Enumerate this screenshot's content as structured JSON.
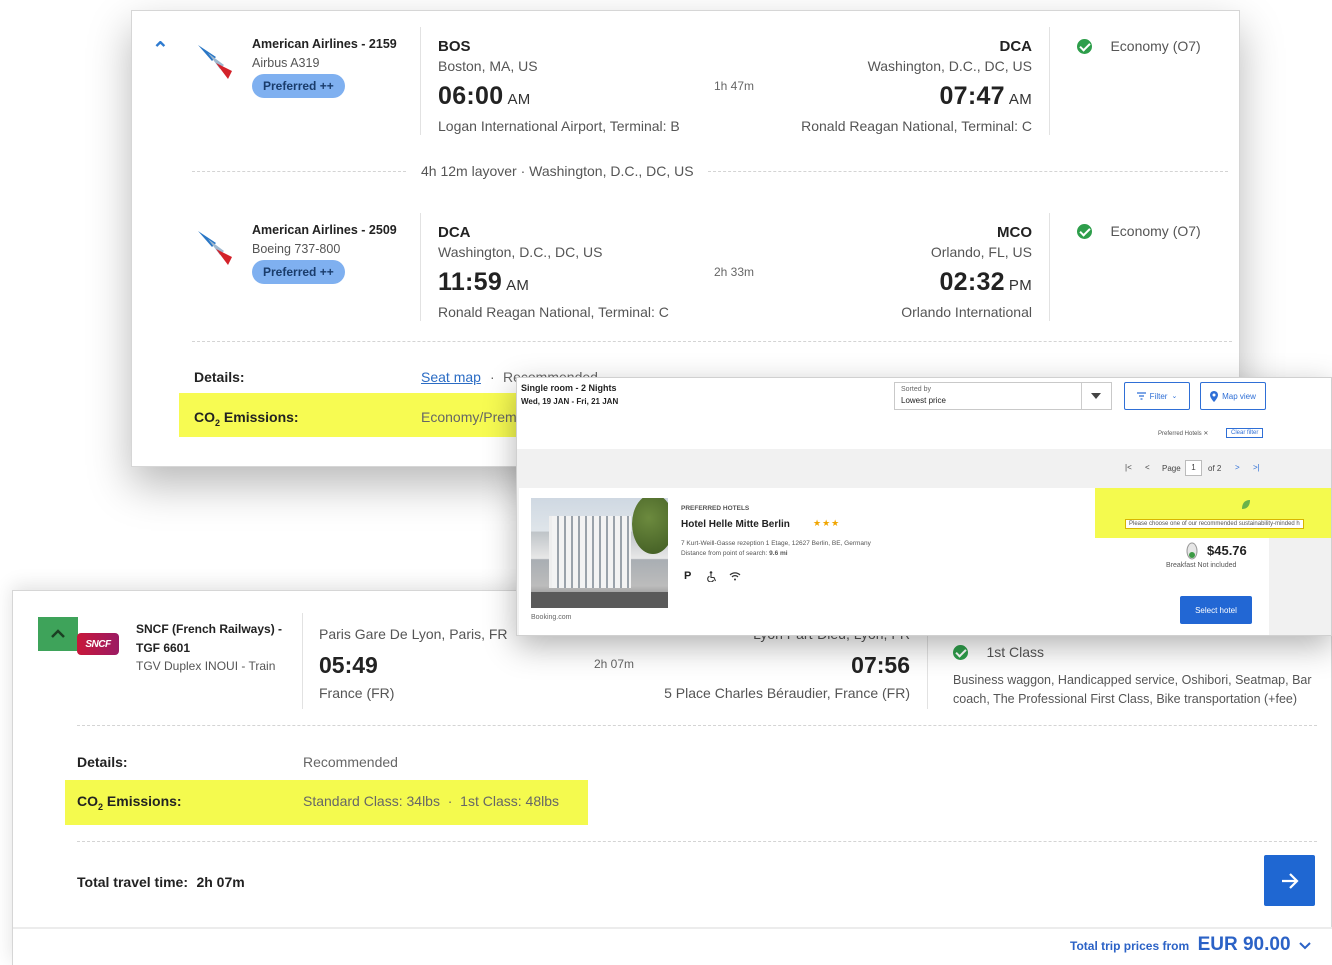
{
  "flight": {
    "segments": [
      {
        "airline": "American Airlines - 2159",
        "aircraft": "Airbus A319",
        "badge": "Preferred ++",
        "dep_code": "BOS",
        "dep_city": "Boston, MA, US",
        "dep_time": "06:00",
        "dep_ampm": "AM",
        "dep_terminal": "Logan International Airport, Terminal: B",
        "duration": "1h 47m",
        "arr_code": "DCA",
        "arr_city": "Washington, D.C., DC, US",
        "arr_time": "07:47",
        "arr_ampm": "AM",
        "arr_terminal": "Ronald Reagan National, Terminal: C",
        "cabin": "Economy (O7)"
      },
      {
        "airline": "American Airlines - 2509",
        "aircraft": "Boeing 737-800",
        "badge": "Preferred ++",
        "dep_code": "DCA",
        "dep_city": "Washington, D.C., DC, US",
        "dep_time": "11:59",
        "dep_ampm": "AM",
        "dep_terminal": "Ronald Reagan National, Terminal: C",
        "duration": "2h 33m",
        "arr_code": "MCO",
        "arr_city": "Orlando, FL, US",
        "arr_time": "02:32",
        "arr_ampm": "PM",
        "arr_terminal": "Orlando International",
        "cabin": "Economy (O7)"
      }
    ],
    "layover": "4h 12m layover · Washington, D.C., DC, US",
    "details_label": "Details:",
    "seat_map": "Seat map",
    "details_sep": "·",
    "recommended": "Recommended",
    "co2_label_pre": "CO",
    "co2_label_sub": "2",
    "co2_label_post": " Emissions:",
    "co2_value": "Economy/Prem"
  },
  "hotel": {
    "room": "Single room - 2 Nights",
    "dates": "Wed, 19 JAN - Fri, 21 JAN",
    "sort_label": "Sorted by",
    "sort_value": "Lowest price",
    "filter": "Filter",
    "map_view": "Map view",
    "chip": "Preferred Hotels",
    "clear_filter": "Clear filter",
    "page_label": "Page",
    "page_num": "1",
    "page_of": "of 2",
    "category": "PREFERRED HOTELS",
    "name": "Hotel Helle Mitte Berlin",
    "stars": "★★★",
    "address": "7 Kurt-Weill-Gasse rezeption 1 Etage, 12627 Berlin, BE, Germany",
    "distance_label": "Distance from point of search:",
    "distance_value": "9.6 mi",
    "image_source": "Booking.com",
    "sustain_note": "Please choose one of our recommended sustainability-minded h",
    "price": "$45.76",
    "breakfast": "Breakfast Not included",
    "select": "Select hotel",
    "colors": {
      "accent": "#2267d4",
      "highlight": "#f4fa4e"
    }
  },
  "train": {
    "operator": "SNCF (French Railways) -",
    "train_no": "TGF 6601",
    "train_type": "TGV Duplex INOUI - Train",
    "logo_text": "SNCF",
    "dep_city": "Paris Gare De Lyon, Paris, FR",
    "dep_time": "05:49",
    "dep_country": "France (FR)",
    "duration": "2h 07m",
    "arr_city": "Lyon Part-Dieu, Lyon, FR",
    "arr_time": "07:56",
    "arr_address": "5 Place Charles Béraudier, France (FR)",
    "class_name": "1st Class",
    "amenities": "Business waggon, Handicapped service, Oshibori, Seatmap, Bar coach, The Professional First Class, Bike transportation (+fee)",
    "details_label": "Details:",
    "recommended": "Recommended",
    "co2_label_pre": "CO",
    "co2_label_sub": "2",
    "co2_label_post": " Emissions:",
    "co2_value": "Standard Class: 34lbs  ·  1st Class: 48lbs",
    "total_travel_label": "Total travel time:",
    "total_travel_value": "2h 07m",
    "total_prices_label": "Total trip prices from",
    "total_prices_value": "EUR 90.00",
    "colors": {
      "green": "#3ea35a",
      "blue": "#1f67d2",
      "highlight": "#f7fb52"
    }
  }
}
